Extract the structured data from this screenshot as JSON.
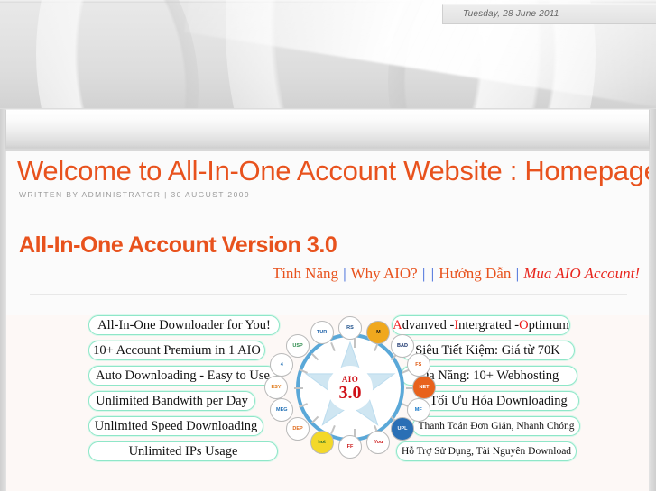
{
  "header": {
    "date_text": "Tuesday, 28 June 2011"
  },
  "navbar": {
    "items": []
  },
  "article": {
    "title": "Welcome to All-In-One Account Website : Homepage!",
    "byline": "WRITTEN BY ADMINISTRATOR | 30 AUGUST 2009",
    "heading": "All-In-One Account Version 3.0"
  },
  "links": {
    "tinh_nang": "Tính Năng",
    "sep1": "|",
    "why_aio": "Why AIO?",
    "sep2": "|",
    "sep3": "|",
    "huong_dan": "Hướng Dẫn",
    "sep4": "|",
    "mua_aio": "Mua AIO Account!"
  },
  "graphic": {
    "center": {
      "label": "AIO",
      "version": "3.0"
    },
    "left_features": [
      "All-In-One Downloader for You!",
      "10+ Account Premium in 1 AIO",
      "Auto Downloading - Easy to Use",
      "Unlimited Bandwith per Day",
      "Unlimited Speed Downloading",
      "Unlimited IPs Usage"
    ],
    "right_features": [
      {
        "parts": [
          {
            "text": "A",
            "highlight": true
          },
          {
            "text": "dvanved - ",
            "highlight": false
          },
          {
            "text": "I",
            "highlight": true
          },
          {
            "text": "ntergrated - ",
            "highlight": false
          },
          {
            "text": "O",
            "highlight": true
          },
          {
            "text": "ptimum",
            "highlight": false
          }
        ]
      },
      {
        "text": "Siêu Tiết Kiệm: Giá từ 70K"
      },
      {
        "text": "Đa Năng: 10+ Webhosting"
      },
      {
        "text": "Tối Ưu Hóa Downloading"
      },
      {
        "text": "Thanh Toán Đơn Giản, Nhanh Chóng",
        "small": true
      },
      {
        "text": "Hỗ Trợ Sử Dụng, Tài Nguyên Download",
        "small": true
      }
    ],
    "logos": [
      {
        "name": "rapidshare",
        "short": "RS",
        "bg": "#ffffff",
        "fg": "#1a4e8a"
      },
      {
        "name": "megaupload",
        "short": "M",
        "bg": "#f0a81e",
        "fg": "#1a1a1a"
      },
      {
        "name": "badongo",
        "short": "BAD",
        "bg": "#ffffff",
        "fg": "#15306b"
      },
      {
        "name": "fileserve",
        "short": "FS",
        "bg": "#ffffff",
        "fg": "#e05a12"
      },
      {
        "name": "netload",
        "short": "NET",
        "bg": "#e8621c",
        "fg": "#ffffff"
      },
      {
        "name": "mediafire",
        "short": "MF",
        "bg": "#ffffff",
        "fg": "#1678c8"
      },
      {
        "name": "uploading",
        "short": "UPL",
        "bg": "#2a6fb5",
        "fg": "#ffffff"
      },
      {
        "name": "youtube",
        "short": "You",
        "bg": "#ffffff",
        "fg": "#cc1a1a"
      },
      {
        "name": "filefactory",
        "short": "FF",
        "bg": "#ffffff",
        "fg": "#cc1a1a"
      },
      {
        "name": "hotfile",
        "short": "hot",
        "bg": "#f3d82a",
        "fg": "#2a6e2a"
      },
      {
        "name": "depositfiles",
        "short": "DEP",
        "bg": "#ffffff",
        "fg": "#e06a1a"
      },
      {
        "name": "megashares",
        "short": "MEG",
        "bg": "#ffffff",
        "fg": "#1f6fb5"
      },
      {
        "name": "easyshare",
        "short": "ESY",
        "bg": "#ffffff",
        "fg": "#e07a1a"
      },
      {
        "name": "fourshared",
        "short": "4",
        "bg": "#ffffff",
        "fg": "#1f6fb5"
      },
      {
        "name": "uploadspeed",
        "short": "USP",
        "bg": "#ffffff",
        "fg": "#2a8a4a"
      },
      {
        "name": "turbobit",
        "short": "TUR",
        "bg": "#ffffff",
        "fg": "#1a5fa8"
      }
    ]
  },
  "colors": {
    "accent_orange": "#e8521d",
    "link_blue": "#2d5bd7",
    "chip_border": "#8fe6c8",
    "ring_blue": "#5aa8d8",
    "star_fill": "#cfe6f2",
    "red": "#cf0f16"
  }
}
